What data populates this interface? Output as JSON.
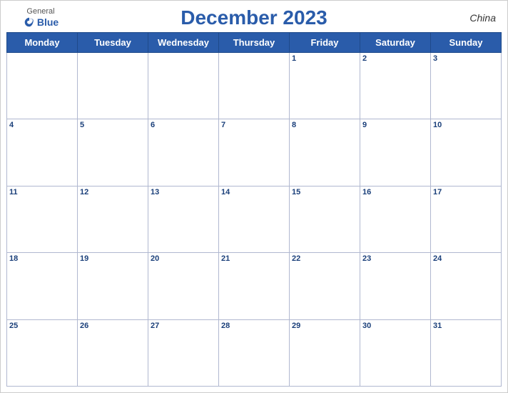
{
  "header": {
    "logo": {
      "general": "General",
      "blue": "Blue"
    },
    "title": "December 2023",
    "country": "China"
  },
  "calendar": {
    "weekdays": [
      "Monday",
      "Tuesday",
      "Wednesday",
      "Thursday",
      "Friday",
      "Saturday",
      "Sunday"
    ],
    "weeks": [
      [
        null,
        null,
        null,
        null,
        1,
        2,
        3
      ],
      [
        4,
        5,
        6,
        7,
        8,
        9,
        10
      ],
      [
        11,
        12,
        13,
        14,
        15,
        16,
        17
      ],
      [
        18,
        19,
        20,
        21,
        22,
        23,
        24
      ],
      [
        25,
        26,
        27,
        28,
        29,
        30,
        31
      ]
    ]
  }
}
